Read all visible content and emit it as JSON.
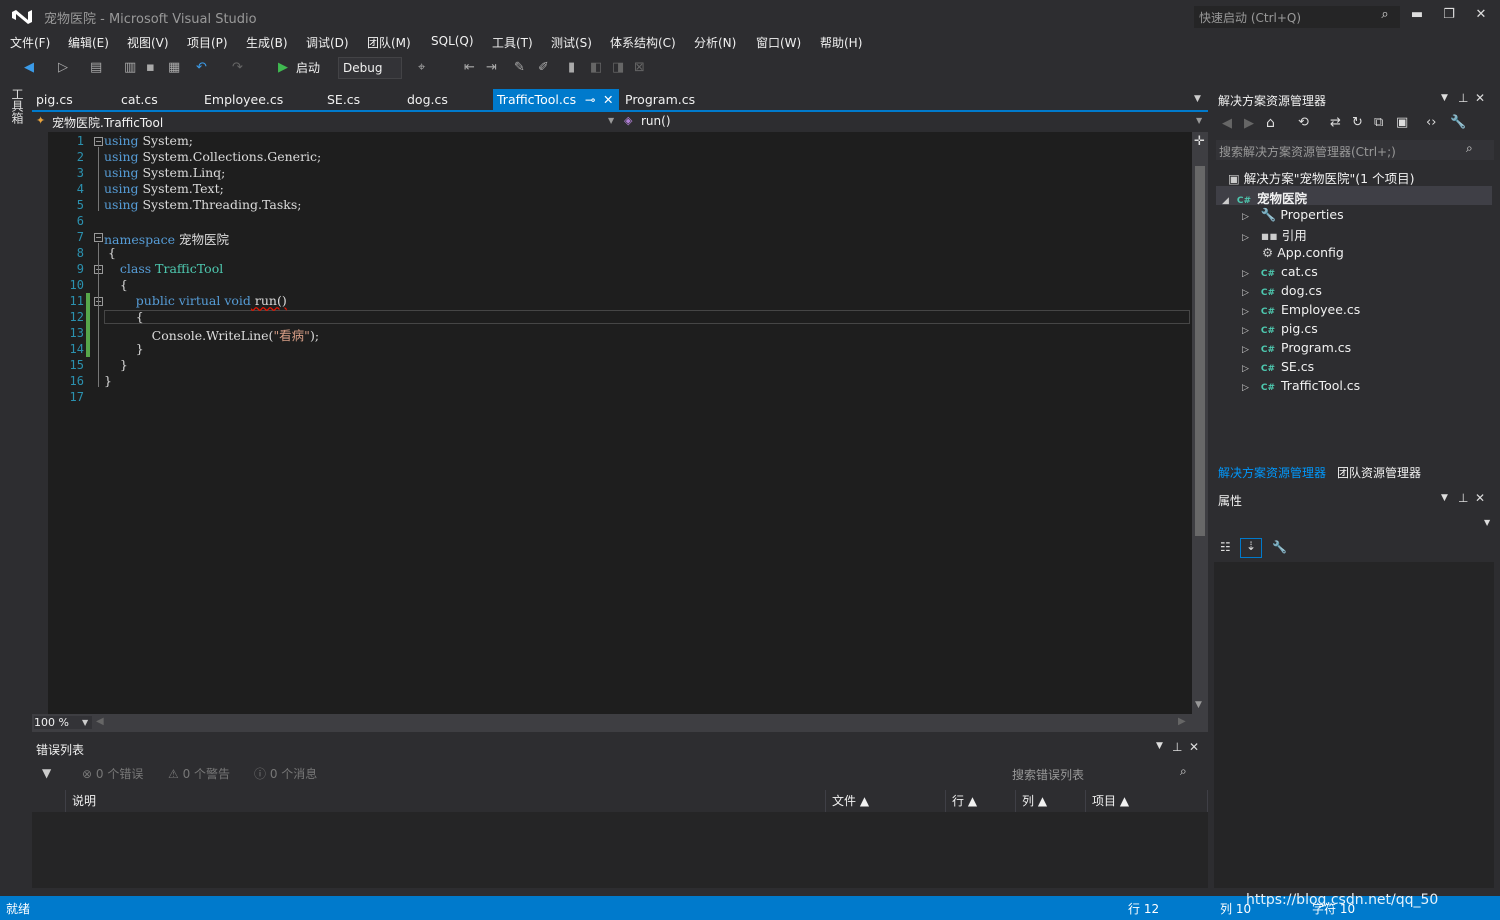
{
  "window": {
    "title": "宠物医院 - Microsoft Visual Studio",
    "quick_launch": "快速启动 (Ctrl+Q)"
  },
  "menu": [
    "文件(F)",
    "编辑(E)",
    "视图(V)",
    "项目(P)",
    "生成(B)",
    "调试(D)",
    "团队(M)",
    "SQL(Q)",
    "工具(T)",
    "测试(S)",
    "体系结构(C)",
    "分析(N)",
    "窗口(W)",
    "帮助(H)"
  ],
  "toolbar": {
    "start_label": "启动",
    "config": "Debug"
  },
  "toolbox_label": "工具箱",
  "tabs": [
    "pig.cs",
    "cat.cs",
    "Employee.cs",
    "SE.cs",
    "dog.cs",
    "TrafficTool.cs",
    "Program.cs"
  ],
  "active_tab": "TrafficTool.cs",
  "navbar": {
    "type": "宠物医院.TrafficTool",
    "member": "run()"
  },
  "code": {
    "line_numbers": [
      "1",
      "2",
      "3",
      "4",
      "5",
      "6",
      "7",
      "8",
      "9",
      "10",
      "11",
      "12",
      "13",
      "14",
      "15",
      "16",
      "17"
    ],
    "l1a": "using",
    "l1b": " System;",
    "l2a": "using",
    "l2b": " System.Collections.Generic;",
    "l3a": "using",
    "l3b": " System.Linq;",
    "l4a": "using",
    "l4b": " System.Text;",
    "l5a": "using",
    "l5b": " System.Threading.Tasks;",
    "l7a": "namespace",
    "l7b": " 宠物医院",
    "l8": " {",
    "l9a": "    class",
    "l9b": " TrafficTool",
    "l10": "    {",
    "l11a": "        public virtual void",
    "l11b": " run()",
    "l12": "        {",
    "l13a": "            Console.WriteLine(",
    "l13b": "\"看病\"",
    "l13c": ");",
    "l14": "        }",
    "l15": "    }",
    "l16": "}"
  },
  "zoom": "100 %",
  "error_list": {
    "title": "错误列表",
    "errors": "0 个错误",
    "warnings": "0 个警告",
    "messages": "0 个消息",
    "search": "搜索错误列表",
    "columns": [
      "说明",
      "文件",
      "行",
      "列",
      "项目"
    ]
  },
  "solution_explorer": {
    "title": "解决方案资源管理器",
    "search": "搜索解决方案资源管理器(Ctrl+;)",
    "solution": "解决方案\"宠物医院\"(1 个项目)",
    "project": "宠物医院",
    "items": [
      "Properties",
      "引用",
      "App.config",
      "cat.cs",
      "dog.cs",
      "Employee.cs",
      "pig.cs",
      "Program.cs",
      "SE.cs",
      "TrafficTool.cs"
    ],
    "bottom_tabs": [
      "解决方案资源管理器",
      "团队资源管理器"
    ]
  },
  "properties": {
    "title": "属性"
  },
  "status": {
    "ready": "就绪",
    "line": "行 12",
    "col": "列 10",
    "char": "字符 10",
    "watermark": "https://blog.csdn.net/qq_50"
  },
  "colors": {
    "accent": "#007acc",
    "editor_bg": "#1e1e1e",
    "chrome": "#2d2d30"
  }
}
